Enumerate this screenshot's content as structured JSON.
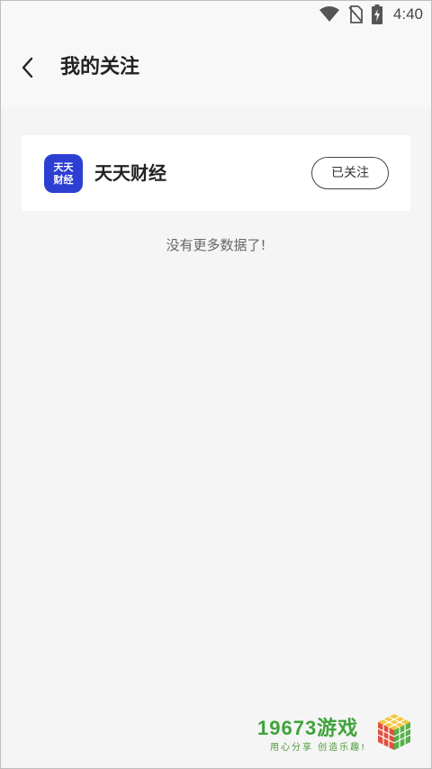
{
  "status_bar": {
    "time": "4:40",
    "icons": [
      "wifi-icon",
      "no-sim-icon",
      "battery-charging-icon"
    ]
  },
  "header": {
    "back_icon": "chevron-left-icon",
    "title": "我的关注"
  },
  "follow_list": [
    {
      "logo_text_line1": "天天",
      "logo_text_line2": "财经",
      "name": "天天财经",
      "button_label": "已关注",
      "logo_color": "#2d3fd3"
    }
  ],
  "footer_message": "没有更多数据了!",
  "watermark": {
    "title": "19673游戏",
    "subtitle": "用心分享 创造乐趣!"
  },
  "colors": {
    "background": "#f5f5f5",
    "card": "#ffffff",
    "accent_blue": "#2d3fd3",
    "watermark_green": "#3fa33a"
  }
}
